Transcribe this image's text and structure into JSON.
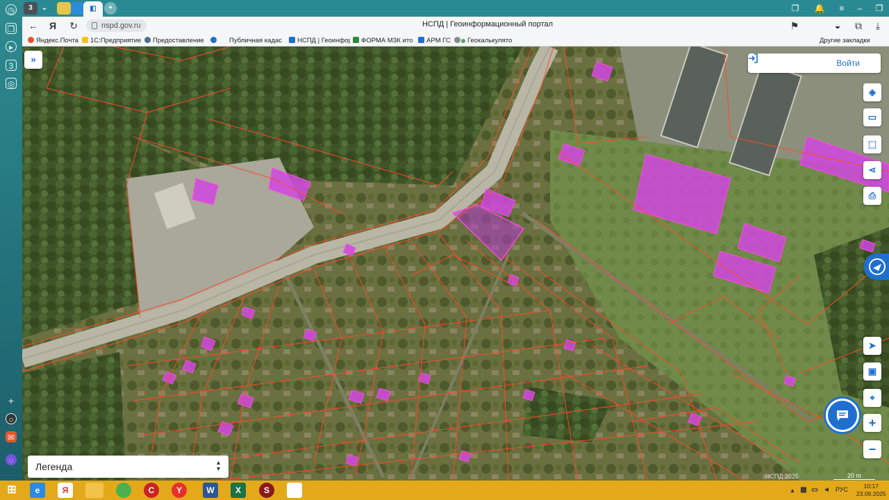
{
  "browser": {
    "url": "nspd.gov.ru",
    "title": "НСПД | Геоинформационный портал",
    "bookmarks": [
      {
        "label": "Яндекс.Почта",
        "color": "#e8542b"
      },
      {
        "label": "1С:Предприятие",
        "color": "#f6c21c"
      },
      {
        "label": "Предоставление",
        "color": "#4f6d8a"
      },
      {
        "label": "Публичная кадас",
        "color": "#1f6fd0"
      },
      {
        "label": "НСПД | Геоинфор",
        "color": "#1f6fd0"
      },
      {
        "label": "ФОРМА МЗК ито",
        "color": "#2a8a3a"
      },
      {
        "label": "АРМ ГС",
        "color": "#1f6fd0"
      },
      {
        "label": "Геокалькулято",
        "color": "#4caf50"
      }
    ],
    "other_bookmarks": "Другие закладки"
  },
  "map": {
    "login_label": "Войти",
    "legend_label": "Легенда",
    "attribution": "НСПД 2025",
    "scale_label": "20 m",
    "accent_color": "#1f6fd0",
    "parcel_color": "#ff4a2a",
    "building_color": "#d046e0",
    "tools": [
      "layers-icon",
      "ruler-icon",
      "select-area-icon",
      "share-icon",
      "print-icon"
    ],
    "nav_tools": [
      "locate-icon",
      "pip-icon",
      "geo-search-icon",
      "zoom-in-icon",
      "zoom-out-icon"
    ]
  },
  "taskbar": {
    "lang": "РУС",
    "time": "10:17",
    "date": "23.09.2025"
  }
}
